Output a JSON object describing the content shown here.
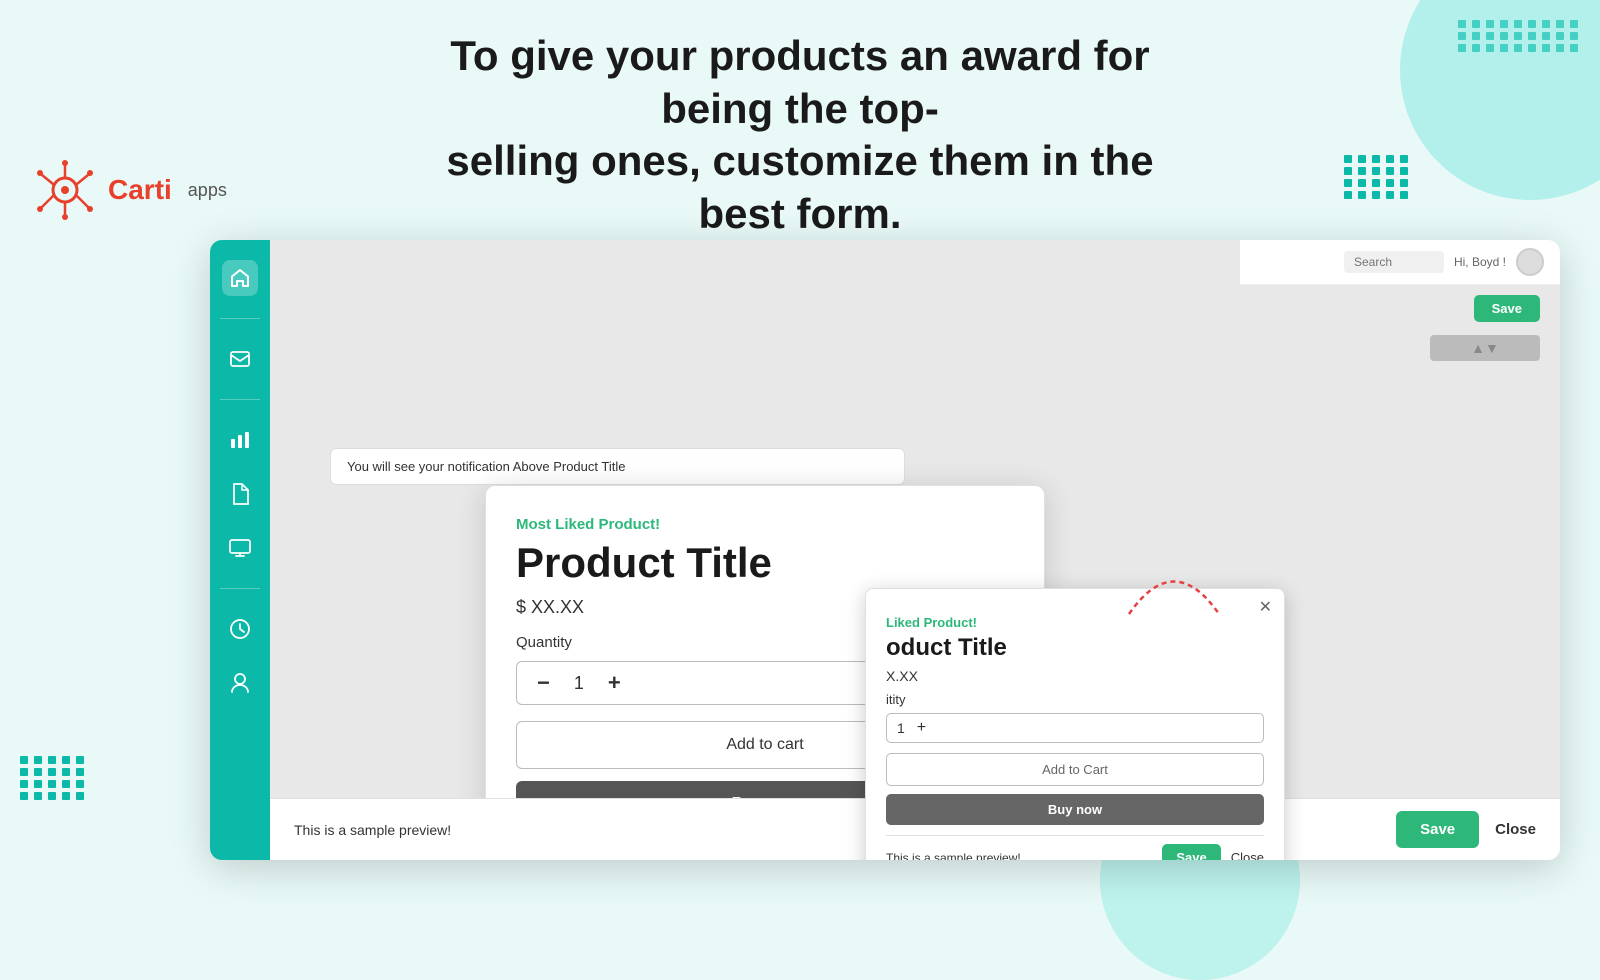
{
  "page": {
    "background_color": "#e8f9f7"
  },
  "header": {
    "title_line1": "To give your products an award for being the top-",
    "title_line2": "selling ones, customize them in the best form."
  },
  "logo": {
    "name": "Carti",
    "apps_label": "apps"
  },
  "notification": {
    "text": "You will see your notification Above  Product Title"
  },
  "modal_large": {
    "badge": "Most Liked Product!",
    "title": "Product Title",
    "price": "$ XX.XX",
    "quantity_label": "Quantity",
    "quantity_value": "1",
    "add_to_cart_label": "Add to cart",
    "buy_now_label": "Buy now",
    "preview_text": "This is a sample preview!",
    "save_label": "Save",
    "close_label": "Close"
  },
  "modal_small": {
    "badge": "Liked Product!",
    "title": "oduct Title",
    "price": "X.XX",
    "quantity_label": "itity",
    "quantity_value": "1",
    "add_to_cart_label": "Add to Cart",
    "buy_now_label": "Buy now",
    "preview_text": "This is a sample preview!",
    "save_label": "Save",
    "close_label": "Close"
  },
  "app_topbar": {
    "search_placeholder": "Search",
    "hi_user": "Hi, Boyd !",
    "save_label": "Save"
  },
  "sidebar": {
    "icons": [
      {
        "name": "home-icon",
        "symbol": "⌂",
        "active": true
      },
      {
        "name": "mail-icon",
        "symbol": "✉",
        "active": false
      },
      {
        "name": "chart-icon",
        "symbol": "▦",
        "active": false
      },
      {
        "name": "document-icon",
        "symbol": "◻",
        "active": false
      },
      {
        "name": "display-icon",
        "symbol": "▣",
        "active": false
      },
      {
        "name": "clock-icon",
        "symbol": "◷",
        "active": false
      },
      {
        "name": "user-icon",
        "symbol": "◉",
        "active": false
      }
    ]
  },
  "most_liked_label": "Most Liked"
}
